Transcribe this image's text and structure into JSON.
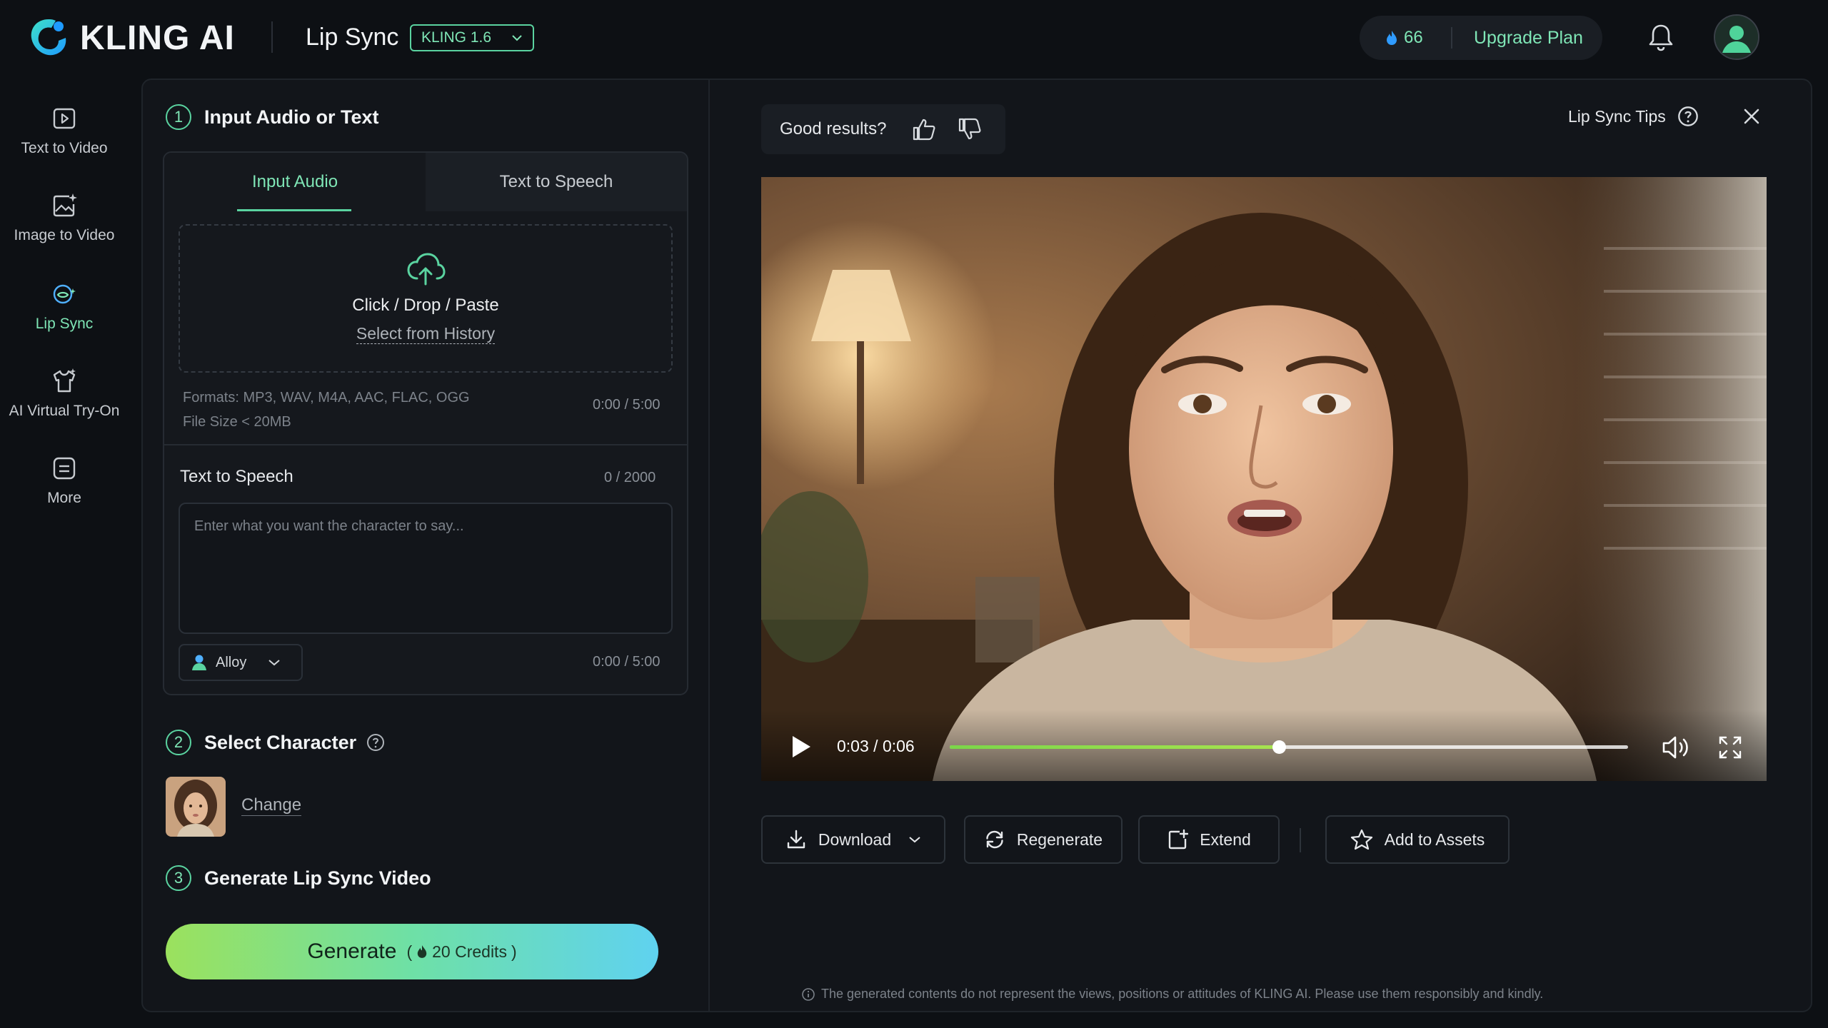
{
  "header": {
    "logo_text": "KLING AI",
    "page_title": "Lip Sync",
    "model": "KLING 1.6",
    "credits": "66",
    "upgrade_label": "Upgrade Plan"
  },
  "nav": [
    {
      "label": "Text to Video",
      "icon": "play-square-icon"
    },
    {
      "label": "Image to Video",
      "icon": "image-sparkle-icon"
    },
    {
      "label": "Lip Sync",
      "icon": "lip-sync-icon",
      "active": true
    },
    {
      "label": "AI Virtual Try-On",
      "icon": "shirt-icon"
    },
    {
      "label": "More",
      "icon": "more-square-icon"
    }
  ],
  "step1": {
    "num": "1",
    "title": "Input Audio or Text",
    "tabs": [
      "Input Audio",
      "Text to Speech"
    ],
    "active_tab": 0,
    "drop_main": "Click / Drop / Paste",
    "drop_link": "Select from History",
    "formats": "Formats: MP3, WAV, M4A, AAC, FLAC, OGG",
    "file_size": "File Size < 20MB",
    "audio_time": "0:00 / 5:00",
    "tts_label": "Text to Speech",
    "char_count": "0 / 2000",
    "tts_placeholder": "Enter what you want the character to say...",
    "voice": "Alloy",
    "tts_time": "0:00 / 5:00"
  },
  "step2": {
    "num": "2",
    "title": "Select Character",
    "change_label": "Change"
  },
  "step3": {
    "num": "3",
    "title": "Generate Lip Sync Video"
  },
  "generate": {
    "label": "Generate",
    "credits": "20 Credits"
  },
  "preview": {
    "feedback_label": "Good results?",
    "tips_label": "Lip Sync Tips",
    "current_time": "0:03",
    "duration": "0:06",
    "progress": 0.485
  },
  "actions": {
    "download": "Download",
    "regenerate": "Regenerate",
    "extend": "Extend",
    "add_assets": "Add to Assets"
  },
  "disclaimer": "The generated contents do not represent the views, positions or attitudes of KLING AI. Please use them responsibly and kindly.",
  "colors": {
    "accent": "#5ad3a0",
    "background": "#0d1014",
    "panel": "#12151a"
  }
}
